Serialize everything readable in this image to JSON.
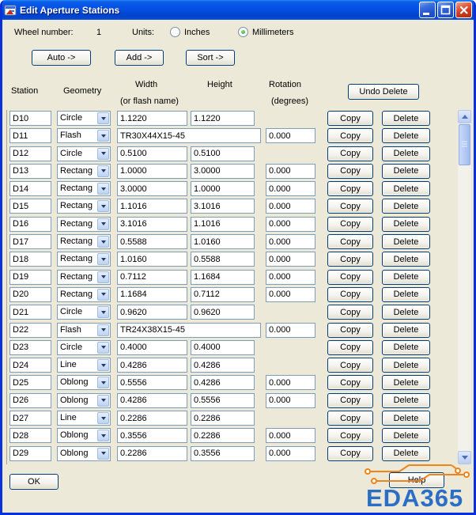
{
  "window": {
    "title": "Edit Aperture Stations"
  },
  "controls": {
    "wheel_label": "Wheel number:",
    "wheel_value": "1",
    "units_label": "Units:",
    "radio_inches": "Inches",
    "radio_millimeters": "Millimeters",
    "selected_units": "Millimeters",
    "auto_button": "Auto ->",
    "add_button": "Add ->",
    "sort_button": "Sort ->",
    "undo_delete_button": "Undo Delete",
    "copy_button": "Copy",
    "delete_button": "Delete",
    "ok_button": "OK",
    "help_button": "Help"
  },
  "headers": {
    "station": "Station",
    "geometry": "Geometry",
    "width": "Width",
    "width_sub": "(or flash name)",
    "height": "Height",
    "rotation": "Rotation",
    "rotation_sub": "(degrees)"
  },
  "rows": [
    {
      "station": "D10",
      "geometry": "Circle",
      "width": "1.1220",
      "height": "1.1220",
      "rotation": null
    },
    {
      "station": "D11",
      "geometry": "Flash",
      "width": "TR30X44X15-45",
      "height": null,
      "rotation": "0.000",
      "flash": true
    },
    {
      "station": "D12",
      "geometry": "Circle",
      "width": "0.5100",
      "height": "0.5100",
      "rotation": null
    },
    {
      "station": "D13",
      "geometry": "Rectang",
      "width": "1.0000",
      "height": "3.0000",
      "rotation": "0.000"
    },
    {
      "station": "D14",
      "geometry": "Rectang",
      "width": "3.0000",
      "height": "1.0000",
      "rotation": "0.000"
    },
    {
      "station": "D15",
      "geometry": "Rectang",
      "width": "1.1016",
      "height": "3.1016",
      "rotation": "0.000"
    },
    {
      "station": "D16",
      "geometry": "Rectang",
      "width": "3.1016",
      "height": "1.1016",
      "rotation": "0.000"
    },
    {
      "station": "D17",
      "geometry": "Rectang",
      "width": "0.5588",
      "height": "1.0160",
      "rotation": "0.000"
    },
    {
      "station": "D18",
      "geometry": "Rectang",
      "width": "1.0160",
      "height": "0.5588",
      "rotation": "0.000"
    },
    {
      "station": "D19",
      "geometry": "Rectang",
      "width": "0.7112",
      "height": "1.1684",
      "rotation": "0.000"
    },
    {
      "station": "D20",
      "geometry": "Rectang",
      "width": "1.1684",
      "height": "0.7112",
      "rotation": "0.000"
    },
    {
      "station": "D21",
      "geometry": "Circle",
      "width": "0.9620",
      "height": "0.9620",
      "rotation": null
    },
    {
      "station": "D22",
      "geometry": "Flash",
      "width": "TR24X38X15-45",
      "height": null,
      "rotation": "0.000",
      "flash": true
    },
    {
      "station": "D23",
      "geometry": "Circle",
      "width": "0.4000",
      "height": "0.4000",
      "rotation": null
    },
    {
      "station": "D24",
      "geometry": "Line",
      "width": "0.4286",
      "height": "0.4286",
      "rotation": null
    },
    {
      "station": "D25",
      "geometry": "Oblong",
      "width": "0.5556",
      "height": "0.4286",
      "rotation": "0.000"
    },
    {
      "station": "D26",
      "geometry": "Oblong",
      "width": "0.4286",
      "height": "0.5556",
      "rotation": "0.000"
    },
    {
      "station": "D27",
      "geometry": "Line",
      "width": "0.2286",
      "height": "0.2286",
      "rotation": null
    },
    {
      "station": "D28",
      "geometry": "Oblong",
      "width": "0.3556",
      "height": "0.2286",
      "rotation": "0.000"
    },
    {
      "station": "D29",
      "geometry": "Oblong",
      "width": "0.2286",
      "height": "0.3556",
      "rotation": "0.000"
    }
  ],
  "logo": {
    "text": "EDA365"
  },
  "colors": {
    "dialog_bg": "#ECE9D8",
    "titlebar_blue": "#0550E4",
    "logo_blue": "#2B6EC8",
    "logo_orange": "#F08418"
  }
}
